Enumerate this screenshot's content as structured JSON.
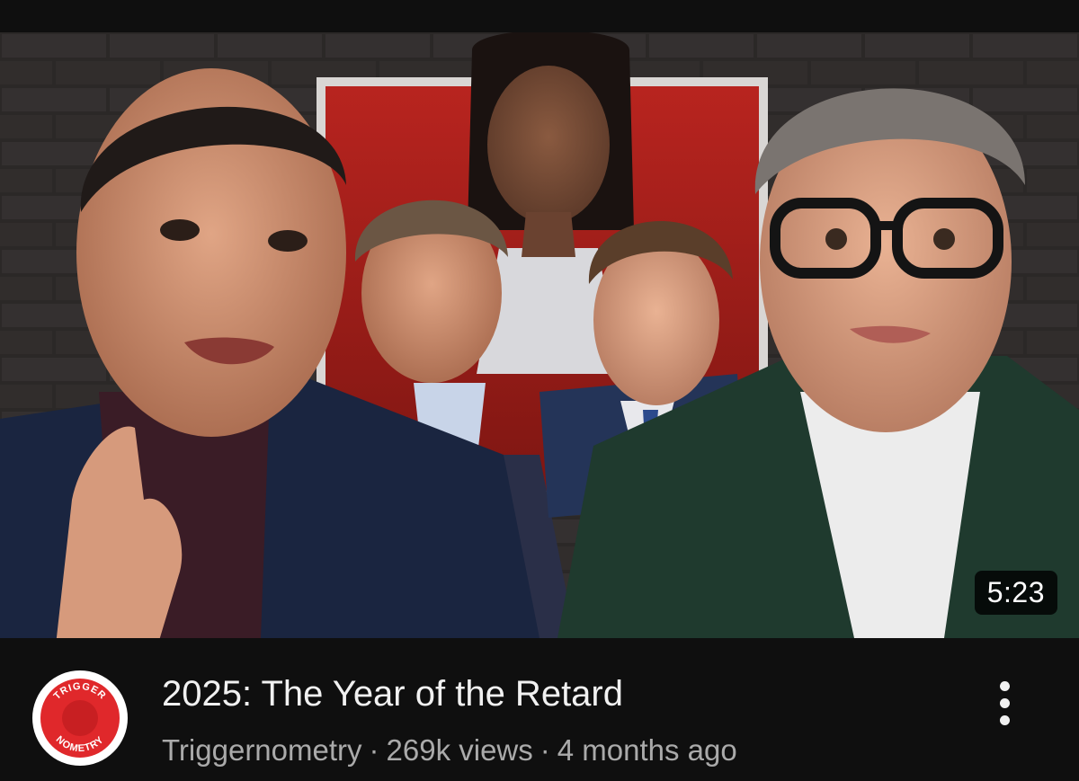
{
  "video": {
    "duration": "5:23",
    "title": "2025: The Year of the Retard",
    "channel": "Triggernometry",
    "views": "269k views",
    "age": "4 months ago",
    "separator": "·"
  },
  "avatar": {
    "top_text": "TRIGGER",
    "bottom_text": "NOMETRY",
    "color": "#e0282b"
  },
  "icons": {
    "more": "vertical-ellipsis-icon"
  },
  "colors": {
    "background": "#0f0f0f",
    "title": "#f1f1f1",
    "subtitle": "#aaaaaa",
    "brand_red": "#e0282b"
  }
}
